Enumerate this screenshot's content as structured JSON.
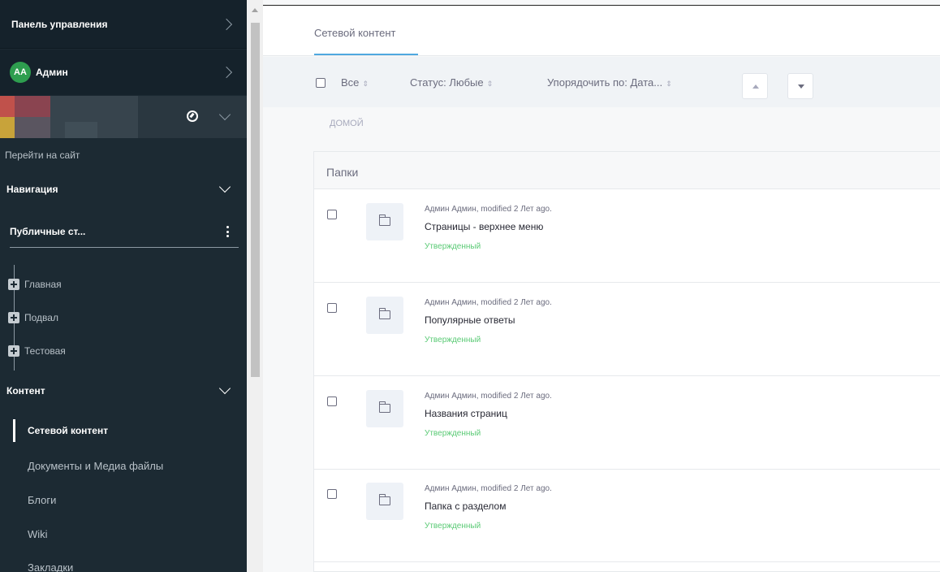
{
  "sidebar": {
    "control_panel": "Панель управления",
    "user": {
      "initials": "AA",
      "name": "Админ"
    },
    "goto_site": "Перейти на сайт",
    "navigation": "Навигация",
    "public_pages": "Публичные ст...",
    "tree": [
      "Главная",
      "Подвал",
      "Тестовая"
    ],
    "content": "Контент",
    "content_items": [
      "Сетевой контент",
      "Документы и Медиа файлы",
      "Блоги",
      "Wiki",
      "Закладки"
    ],
    "active_item": "Сетевой контент"
  },
  "main": {
    "tab": "Сетевой контент",
    "toolbar": {
      "all": "Все",
      "status": "Статус: Любые",
      "order": "Упорядочить по: Дата..."
    },
    "breadcrumb": "домой",
    "folders_header": "Папки",
    "rows": [
      {
        "meta": "Админ Админ, modified 2 Лет ago.",
        "title": "Страницы - верхнее меню",
        "status": "Утвержденный"
      },
      {
        "meta": "Админ Админ, modified 2 Лет ago.",
        "title": "Популярные ответы",
        "status": "Утвержденный"
      },
      {
        "meta": "Админ Админ, modified 2 Лет ago.",
        "title": "Названия страниц",
        "status": "Утвержденный"
      },
      {
        "meta": "Админ Админ, modified 2 Лет ago.",
        "title": "Папка с разделом",
        "status": "Утвержденный"
      }
    ]
  },
  "colors": {
    "sidebar_bg": "#1c2a33",
    "accent": "#4fa8df",
    "approved": "#5aca75",
    "avatar": "#2e9e4f"
  }
}
